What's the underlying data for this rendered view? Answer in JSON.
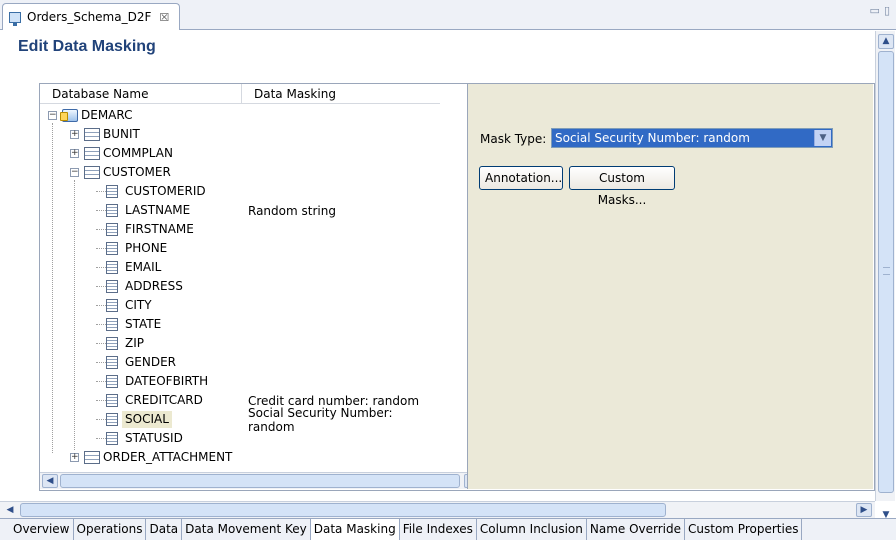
{
  "editor": {
    "tab_label": "Orders_Schema_D2F",
    "tab_close": "☒",
    "window_controls": [
      "▭",
      "▯"
    ]
  },
  "page": {
    "title": "Edit Data Masking"
  },
  "tree": {
    "columns": [
      "Database Name",
      "Data Masking"
    ],
    "rows": [
      {
        "label": "DEMARC",
        "mask": "",
        "type": "database",
        "level": 0,
        "expander": "−"
      },
      {
        "label": "BUNIT",
        "mask": "",
        "type": "table",
        "level": 1,
        "expander": "+"
      },
      {
        "label": "COMMPLAN",
        "mask": "",
        "type": "table",
        "level": 1,
        "expander": "+"
      },
      {
        "label": "CUSTOMER",
        "mask": "",
        "type": "table",
        "level": 1,
        "expander": "−"
      },
      {
        "label": "CUSTOMERID",
        "mask": "",
        "type": "column",
        "level": 2
      },
      {
        "label": "LASTNAME",
        "mask": "Random string",
        "type": "column",
        "level": 2
      },
      {
        "label": "FIRSTNAME",
        "mask": "",
        "type": "column",
        "level": 2
      },
      {
        "label": "PHONE",
        "mask": "",
        "type": "column",
        "level": 2
      },
      {
        "label": "EMAIL",
        "mask": "",
        "type": "column",
        "level": 2
      },
      {
        "label": "ADDRESS",
        "mask": "",
        "type": "column",
        "level": 2
      },
      {
        "label": "CITY",
        "mask": "",
        "type": "column",
        "level": 2
      },
      {
        "label": "STATE",
        "mask": "",
        "type": "column",
        "level": 2
      },
      {
        "label": "ZIP",
        "mask": "",
        "type": "column",
        "level": 2
      },
      {
        "label": "GENDER",
        "mask": "",
        "type": "column",
        "level": 2
      },
      {
        "label": "DATEOFBIRTH",
        "mask": "",
        "type": "column",
        "level": 2
      },
      {
        "label": "CREDITCARD",
        "mask": "Credit card number: random",
        "type": "column",
        "level": 2
      },
      {
        "label": "SOCIAL",
        "mask": "Social Security Number: random",
        "type": "column",
        "level": 2,
        "selected": true
      },
      {
        "label": "STATUSID",
        "mask": "",
        "type": "column",
        "level": 2
      },
      {
        "label": "ORDER_ATTACHMENT",
        "mask": "",
        "type": "table",
        "level": 1,
        "expander": "+"
      }
    ]
  },
  "settings": {
    "mask_type_label": "Mask Type:",
    "mask_type_value": "Social Security Number: random",
    "annotation_button": "Annotation...",
    "custom_masks_button": "Custom Masks..."
  },
  "bottom_tabs": [
    {
      "label": "Overview",
      "active": false
    },
    {
      "label": "Operations",
      "active": false
    },
    {
      "label": "Data",
      "active": false
    },
    {
      "label": "Data Movement Key",
      "active": false
    },
    {
      "label": "Data Masking",
      "active": true
    },
    {
      "label": "File Indexes",
      "active": false
    },
    {
      "label": "Column Inclusion",
      "active": false
    },
    {
      "label": "Name Override",
      "active": false
    },
    {
      "label": "Custom Properties",
      "active": false
    }
  ],
  "icons": {
    "database": "database-icon",
    "table": "table-icon",
    "column": "column-icon"
  }
}
